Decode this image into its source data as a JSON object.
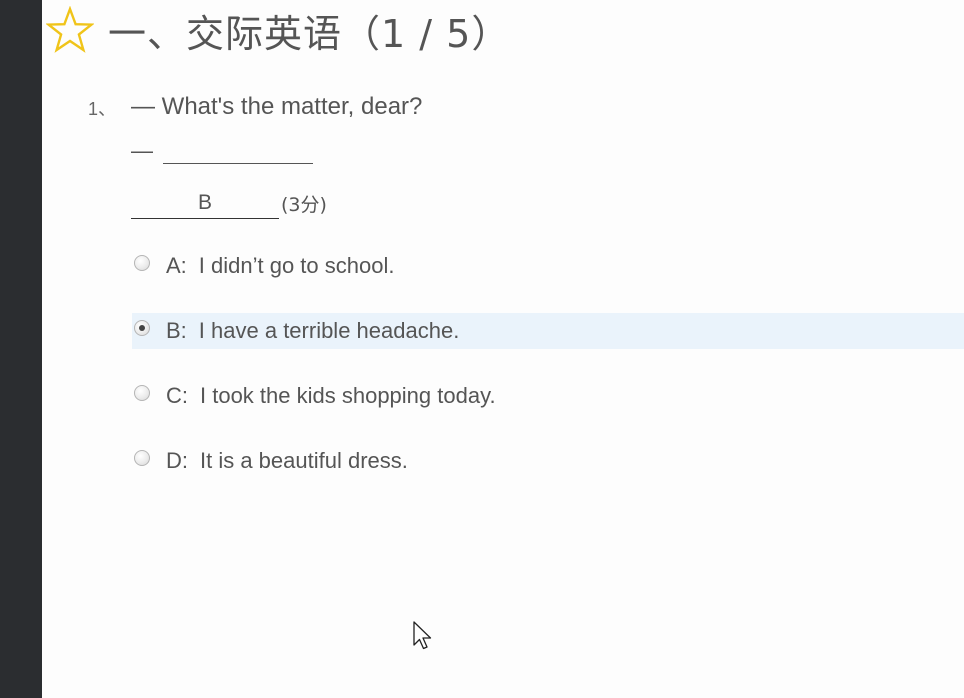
{
  "section": {
    "title": "一、交际英语（1 / 5）",
    "icon": "star-outline-icon",
    "icon_color": "#f0c419"
  },
  "question": {
    "number": "1、",
    "line1": "— What's the matter, dear?",
    "line2_prefix": "—",
    "answer": "B",
    "score": "(3分)",
    "options": [
      {
        "letter": "A:",
        "text": "I didn’t go to school.",
        "selected": false
      },
      {
        "letter": "B:",
        "text": "I have a terrible headache.",
        "selected": true
      },
      {
        "letter": "C:",
        "text": "I took the kids shopping today.",
        "selected": false
      },
      {
        "letter": "D:",
        "text": "It is a beautiful dress.",
        "selected": false
      }
    ]
  },
  "colors": {
    "sidebar": "#2b2d30",
    "selected_row": "#eaf3fb",
    "text": "#555555"
  }
}
